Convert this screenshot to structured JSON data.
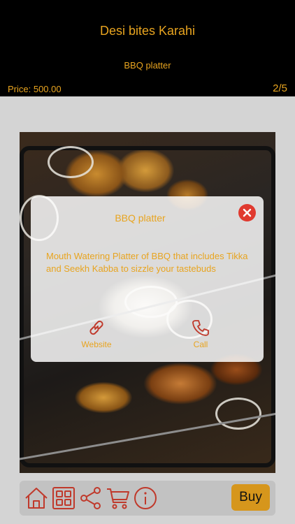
{
  "header": {
    "title": "Desi bites Karahi",
    "item_name": "BBQ platter",
    "price": "Price: 500.00",
    "counter": "2/5"
  },
  "popup": {
    "title": "BBQ platter",
    "description": "Mouth Watering Platter of BBQ that includes Tikka and Seekh Kabba to sizzle your tastebuds",
    "website_label": "Website",
    "call_label": "Call",
    "close_icon": "close-icon"
  },
  "toolbar": {
    "items": [
      {
        "icon": "home-icon"
      },
      {
        "icon": "grid-icon"
      },
      {
        "icon": "share-icon"
      },
      {
        "icon": "cart-icon"
      },
      {
        "icon": "info-icon"
      }
    ],
    "buy_label": "Buy"
  },
  "colors": {
    "accent": "#e8a41f",
    "header_bg": "#000000",
    "page_bg": "#d4d4d4",
    "close": "#e03a2f",
    "buy_button": "#d6961c",
    "toolbar_icon": "#c0392b"
  }
}
